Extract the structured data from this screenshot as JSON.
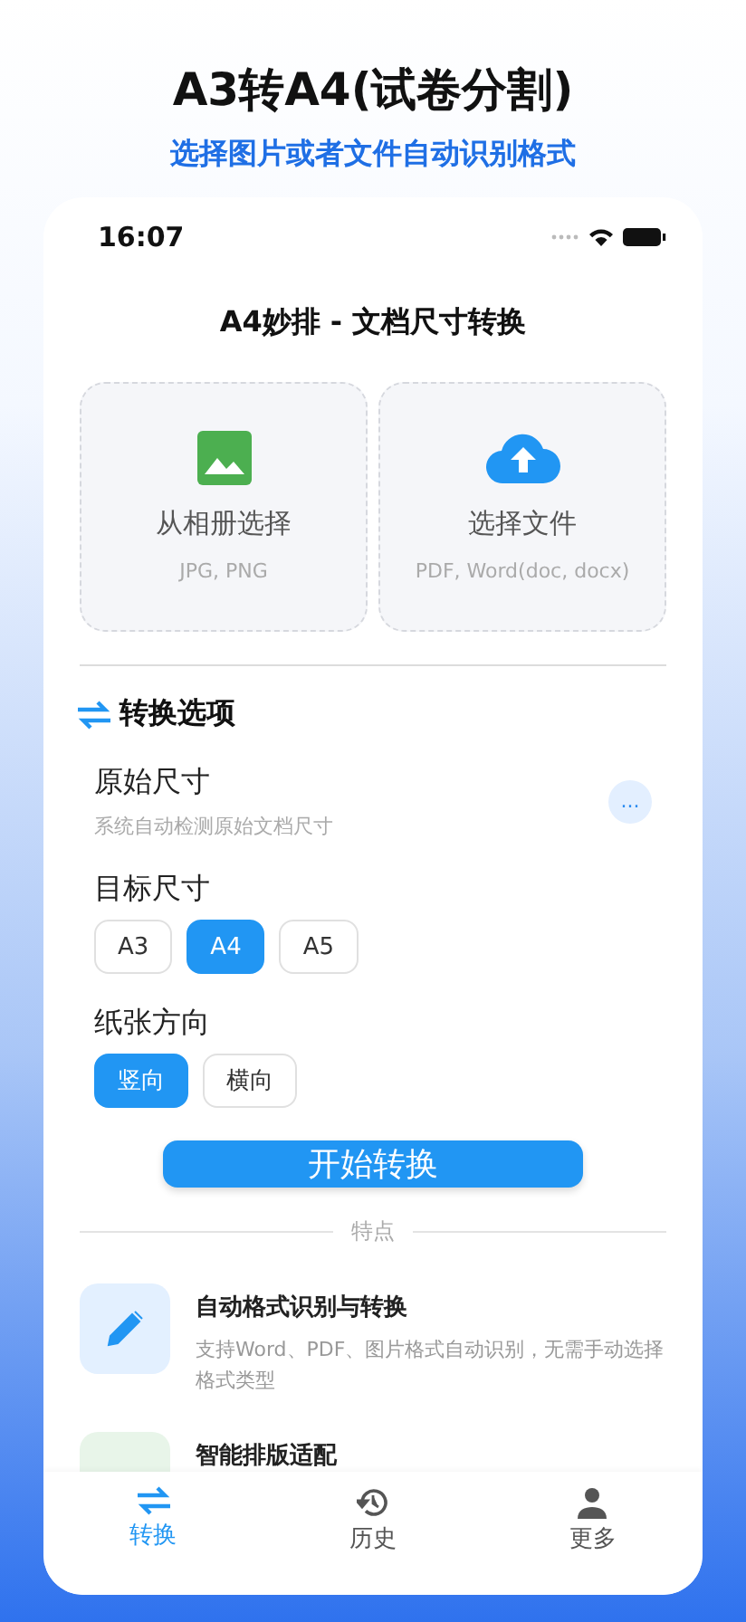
{
  "header": {
    "title": "A3转A4(试卷分割)",
    "subtitle": "选择图片或者文件自动识别格式"
  },
  "status_bar": {
    "time": "16:07"
  },
  "screen_title": "A4妙排 - 文档尺寸转换",
  "upload_options": [
    {
      "kind": "image",
      "label": "从相册选择",
      "formats": "JPG, PNG"
    },
    {
      "kind": "cloud",
      "label": "选择文件",
      "formats": "PDF, Word(doc, docx)"
    }
  ],
  "options_section": {
    "title": "转换选项",
    "original_size": {
      "label": "原始尺寸",
      "hint": "系统自动检测原始文档尺寸",
      "more": "..."
    },
    "target_size": {
      "label": "目标尺寸",
      "choices": [
        {
          "label": "A3",
          "selected": false
        },
        {
          "label": "A4",
          "selected": true
        },
        {
          "label": "A5",
          "selected": false
        }
      ]
    },
    "orientation": {
      "label": "纸张方向",
      "choices": [
        {
          "label": "竖向",
          "selected": true
        },
        {
          "label": "横向",
          "selected": false
        }
      ]
    }
  },
  "start_button": "开始转换",
  "features_heading": "特点",
  "features": [
    {
      "kind": "pencil",
      "title": "自动格式识别与转换",
      "description": "支持Word、PDF、图片格式自动识别，无需手动选择格式类型"
    },
    {
      "kind": "layout",
      "title": "智能排版适配"
    }
  ],
  "tabs": [
    {
      "kind": "convert",
      "label": "转换",
      "selected": true
    },
    {
      "kind": "history",
      "label": "历史",
      "selected": false
    },
    {
      "kind": "more",
      "label": "更多",
      "selected": false
    }
  ]
}
